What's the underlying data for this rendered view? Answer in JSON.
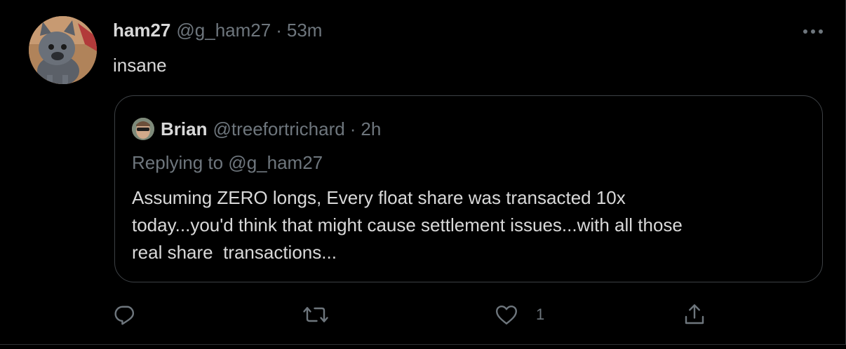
{
  "tweet": {
    "author_name": "ham27",
    "author_handle": "@g_ham27",
    "separator": "·",
    "timestamp": "53m",
    "text": "insane",
    "more_icon": "more-horizontal-icon"
  },
  "quoted_tweet": {
    "author_name": "Brian",
    "author_handle": "@treefortrichard",
    "separator": "·",
    "timestamp": "2h",
    "replying_to": "Replying to @g_ham27",
    "text_lines": [
      "Assuming ZERO longs, Every float share was transacted 10x",
      "today...you'd think that might cause settlement issues...with all those",
      "real share  transactions..."
    ]
  },
  "actions": {
    "reply_icon": "reply-icon",
    "retweet_icon": "retweet-icon",
    "like_icon": "heart-icon",
    "like_count": "1",
    "share_icon": "share-icon"
  },
  "colors": {
    "background": "#000000",
    "primary_text": "#d9d9d9",
    "secondary_text": "#6e767d",
    "border": "#3d4145"
  }
}
